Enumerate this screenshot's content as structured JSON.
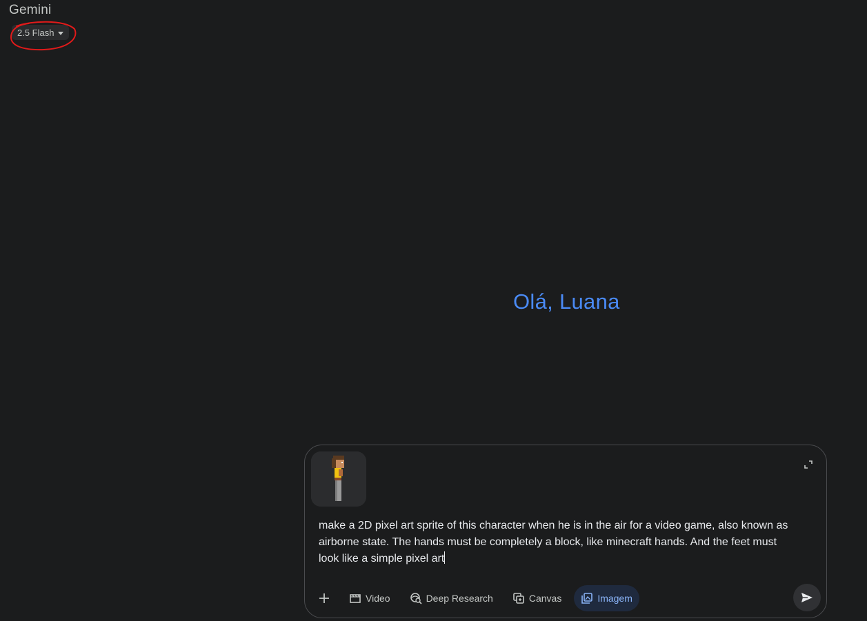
{
  "header": {
    "app_title": "Gemini",
    "model_label": "2.5 Flash"
  },
  "greeting": "Olá, Luana",
  "composer": {
    "prompt_line1": "make a 2D pixel art sprite of this character when he is in the air for a video game, also known as",
    "prompt_line2": "airborne state. The hands must be completely a block, like minecraft hands. And the feet must",
    "prompt_line3": "look like a simple pixel art",
    "attachment_icon": "pixel-character-thumbnail",
    "tools": [
      {
        "label": "",
        "icon": "plus-icon"
      },
      {
        "label": "Video",
        "icon": "video-icon"
      },
      {
        "label": "Deep Research",
        "icon": "deep-research-icon"
      },
      {
        "label": "Canvas",
        "icon": "canvas-icon"
      },
      {
        "label": "Imagem",
        "icon": "image-icon",
        "active": true
      }
    ],
    "send_icon": "send-icon",
    "expand_icon": "expand-icon"
  },
  "colors": {
    "background": "#1b1c1d",
    "accent": "#4a8af4",
    "active_tool_bg": "#1f2a3e",
    "annotation": "#e11a1a"
  }
}
